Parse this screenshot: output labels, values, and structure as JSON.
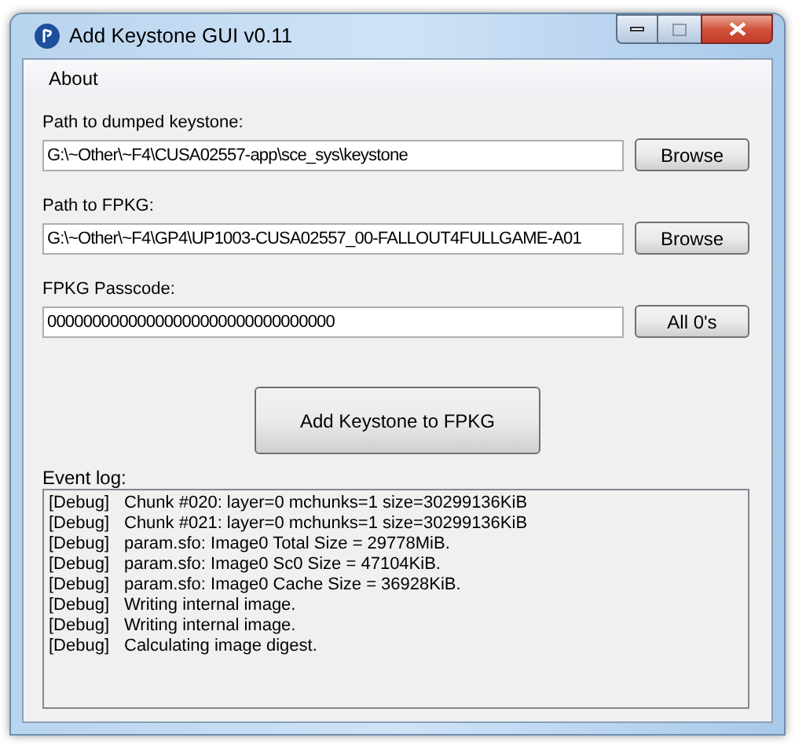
{
  "window": {
    "title": "Add Keystone GUI v0.11"
  },
  "menu": [
    "About"
  ],
  "fields": [
    {
      "label": "Path to dumped keystone:",
      "value": "G:\\~Other\\~F4\\CUSA02557-app\\sce_sys\\keystone",
      "button": "Browse"
    },
    {
      "label": "Path to FPKG:",
      "value": "G:\\~Other\\~F4\\GP4\\UP1003-CUSA02557_00-FALLOUT4FULLGAME-A01",
      "button": "Browse"
    },
    {
      "label": "FPKG Passcode:",
      "value": "00000000000000000000000000000000",
      "button": "All 0's"
    }
  ],
  "action_button": "Add Keystone to FPKG",
  "event_log": {
    "label": "Event log:",
    "entries": [
      {
        "tag": "[Debug]",
        "message": "Chunk #020: layer=0 mchunks=1 size=30299136KiB"
      },
      {
        "tag": "[Debug]",
        "message": "Chunk #021: layer=0 mchunks=1 size=30299136KiB"
      },
      {
        "tag": "[Debug]",
        "message": "param.sfo: Image0 Total Size = 29778MiB."
      },
      {
        "tag": "[Debug]",
        "message": "param.sfo: Image0 Sc0 Size = 47104KiB."
      },
      {
        "tag": "[Debug]",
        "message": "param.sfo: Image0 Cache Size = 36928KiB."
      },
      {
        "tag": "[Debug]",
        "message": "Writing internal image."
      },
      {
        "tag": "[Debug]",
        "message": "Writing internal image."
      },
      {
        "tag": "[Debug]",
        "message": "Calculating image digest."
      }
    ]
  }
}
